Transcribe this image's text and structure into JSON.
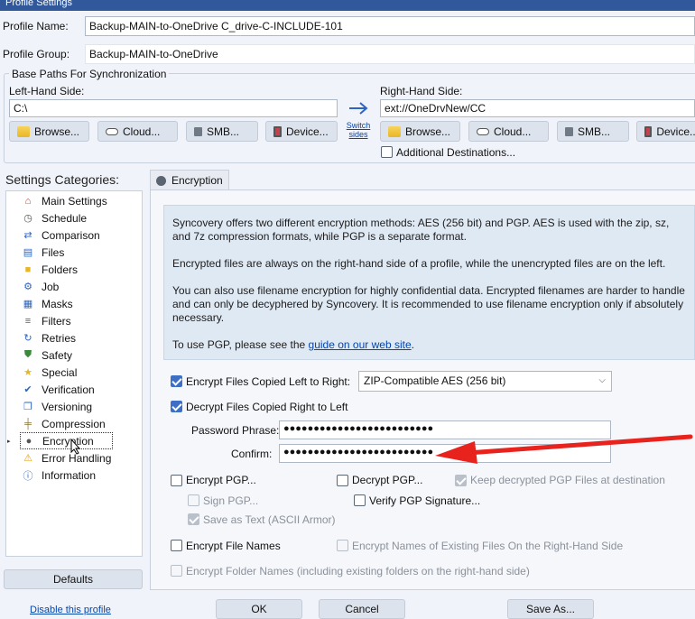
{
  "window": {
    "title": "Profile Settings"
  },
  "profile": {
    "name_label": "Profile Name:",
    "name_value": "Backup-MAIN-to-OneDrive C_drive-C-INCLUDE-101",
    "group_label": "Profile Group:",
    "group_value": "Backup-MAIN-to-OneDrive"
  },
  "base_paths": {
    "title": "Base Paths For Synchronization",
    "left_label": "Left-Hand Side:",
    "left_value": "C:\\",
    "right_label": "Right-Hand Side:",
    "right_value": "ext://OneDrvNew/CC",
    "switch_line1": "Switch",
    "switch_line2": "sides",
    "browse": "Browse...",
    "cloud": "Cloud...",
    "smb": "SMB...",
    "device": "Device...",
    "additional_destinations": "Additional Destinations..."
  },
  "sidebar": {
    "title": "Settings Categories:",
    "items": [
      {
        "label": "Main Settings",
        "icon": "house-icon"
      },
      {
        "label": "Schedule",
        "icon": "clock-icon"
      },
      {
        "label": "Comparison",
        "icon": "comparison-icon"
      },
      {
        "label": "Files",
        "icon": "files-icon"
      },
      {
        "label": "Folders",
        "icon": "folder-icon"
      },
      {
        "label": "Job",
        "icon": "job-icon"
      },
      {
        "label": "Masks",
        "icon": "masks-icon"
      },
      {
        "label": "Filters",
        "icon": "filter-icon"
      },
      {
        "label": "Retries",
        "icon": "retry-icon"
      },
      {
        "label": "Safety",
        "icon": "shield-icon"
      },
      {
        "label": "Special",
        "icon": "star-icon"
      },
      {
        "label": "Verification",
        "icon": "check-icon"
      },
      {
        "label": "Versioning",
        "icon": "versions-icon"
      },
      {
        "label": "Compression",
        "icon": "compression-icon"
      },
      {
        "label": "Encryption",
        "icon": "lock-icon"
      },
      {
        "label": "Error Handling",
        "icon": "warning-icon"
      },
      {
        "label": "Information",
        "icon": "info-icon"
      }
    ],
    "selected": "Encryption",
    "defaults_button": "Defaults",
    "disable_link": "Disable this profile"
  },
  "tab": {
    "label": "Encryption"
  },
  "info": {
    "p1": "Syncovery offers two different encryption methods: AES (256 bit) and PGP. AES is used with the zip, sz, and 7z compression formats, while PGP is a separate format.",
    "p2": "Encrypted files are always on the right-hand side of a profile, while the unencrypted files are on the left.",
    "p3": "You can also use filename encryption for highly confidential data. Encrypted filenames are harder to handle and can only be decyphered by Syncovery. It is recommended to use filename encryption only if absolutely necessary.",
    "p4_prefix": "To use PGP, please see the ",
    "p4_link": "guide on our web site",
    "p4_suffix": "."
  },
  "encryption": {
    "encrypt_files_label": "Encrypt Files Copied Left to Right:",
    "method_selected": "ZIP-Compatible AES (256 bit)",
    "decrypt_files_label": "Decrypt Files Copied Right to Left",
    "password_label": "Password Phrase:",
    "password_value": "●●●●●●●●●●●●●●●●●●●●●●●●●",
    "confirm_label": "Confirm:",
    "confirm_value": "●●●●●●●●●●●●●●●●●●●●●●●●●",
    "encrypt_pgp": "Encrypt PGP...",
    "decrypt_pgp": "Decrypt PGP...",
    "keep_decrypted": "Keep decrypted PGP Files at destination",
    "sign_pgp": "Sign PGP...",
    "verify_pgp": "Verify PGP Signature...",
    "save_as_text": "Save as Text (ASCII Armor)",
    "encrypt_file_names": "Encrypt File Names",
    "encrypt_existing_names": "Encrypt Names of Existing Files On the Right-Hand Side",
    "encrypt_folder_names": "Encrypt Folder Names (including existing folders on the right-hand side)"
  },
  "footer": {
    "ok": "OK",
    "cancel": "Cancel",
    "save_as": "Save As..."
  },
  "colors": {
    "accent": "#3d6fc4",
    "arrow": "#e8231e",
    "link": "#0645ad"
  }
}
